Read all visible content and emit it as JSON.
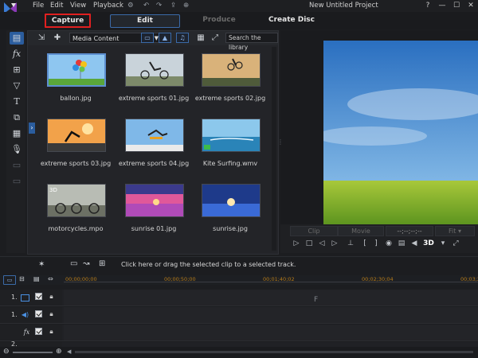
{
  "menubar": {
    "badge_number": "2",
    "menu": [
      "File",
      "Edit",
      "View",
      "Playback"
    ],
    "project_title": "New Untitled Project",
    "window_buttons": [
      "?",
      "—",
      "☐",
      "✕"
    ]
  },
  "modes": {
    "capture": "Capture",
    "edit": "Edit",
    "produce": "Produce",
    "create_disc": "Create Disc"
  },
  "library": {
    "content_select": "Media Content",
    "search_placeholder": "Search the library",
    "items": [
      {
        "label": "ballon.jpg"
      },
      {
        "label": "extreme sports 01.jpg"
      },
      {
        "label": "extreme sports 02.jpg"
      },
      {
        "label": "extreme sports 03.jpg"
      },
      {
        "label": "extreme sports 04.jpg"
      },
      {
        "label": "Kite Surfing.wmv"
      },
      {
        "label": "motorcycles.mpo"
      },
      {
        "label": "sunrise 01.jpg"
      },
      {
        "label": "sunrise.jpg"
      }
    ],
    "badge_3d": "3D"
  },
  "preview": {
    "clip_tab": "Clip",
    "movie_tab": "Movie",
    "timecode": "--;--;--;--",
    "fit_select": "Fit",
    "three_d": "3D"
  },
  "timeline": {
    "hint": "Click here or drag the selected clip to a selected track.",
    "ruler": [
      "00;00;00;00",
      "00;00;50;00",
      "00;01;40;02",
      "00;02;30;04",
      "00;03;20;06"
    ],
    "tracks": [
      {
        "num": "1."
      },
      {
        "num": "1."
      },
      {
        "num": ""
      },
      {
        "num": "2."
      }
    ],
    "track_marker": "F"
  },
  "colors": {
    "accent_blue": "#3b6aa8",
    "capture_highlight": "#e02020",
    "ruler_text": "#b57b1a"
  }
}
